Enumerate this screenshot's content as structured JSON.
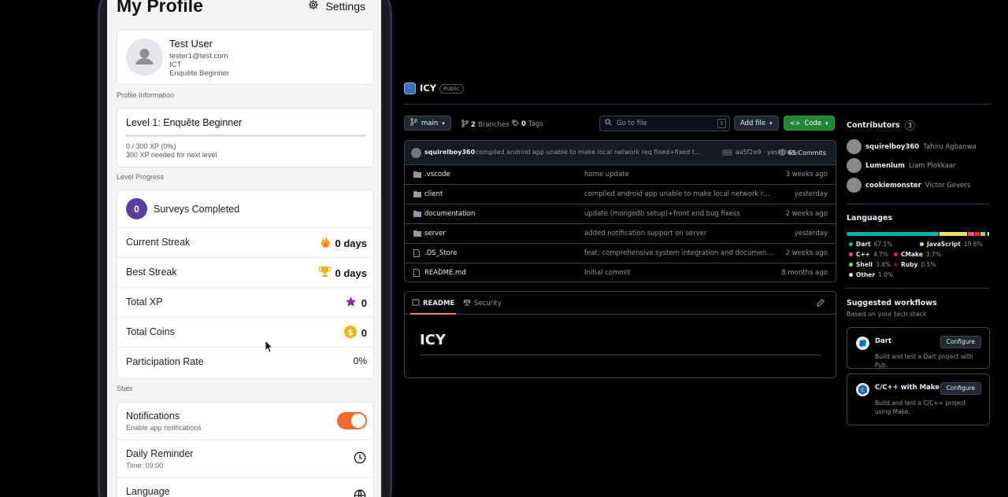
{
  "profile": {
    "title": "My Profile",
    "settings_label": "Settings",
    "user": {
      "name": "Test User",
      "email": "tester1@test.com",
      "org": "ICT",
      "rank": "Enquête Beginner"
    },
    "section_profile_info": "Profile Information",
    "level": {
      "title": "Level 1: Enquête Beginner",
      "xp_text": "0 / 300 XP (0%)",
      "next_text": "300 XP needed for next level",
      "progress_fraction": 0
    },
    "section_level_progress": "Level Progress",
    "stats": {
      "surveys_count": "0",
      "surveys_label": "Surveys Completed",
      "current_streak_label": "Current Streak",
      "current_streak_value": "0 days",
      "best_streak_label": "Best Streak",
      "best_streak_value": "0 days",
      "total_xp_label": "Total XP",
      "total_xp_value": "0",
      "total_coins_label": "Total Coins",
      "total_coins_value": "0",
      "participation_label": "Participation Rate",
      "participation_value": "0%"
    },
    "section_stats": "Stats",
    "prefs": {
      "notifications_label": "Notifications",
      "notifications_sub": "Enable app notifications",
      "notifications_on": true,
      "reminder_label": "Daily Reminder",
      "reminder_sub": "Time: 09:00",
      "language_label": "Language"
    },
    "colors": {
      "accent": "#5b3f9c",
      "toggle": "#f26a2e"
    }
  },
  "github": {
    "repo_name": "ICY",
    "visibility": "Public",
    "branch": "main",
    "branches_count": "2",
    "branches_label": "Branches",
    "tags_count": "0",
    "tags_label": "Tags",
    "search_placeholder": "Go to file",
    "search_kbd": "t",
    "add_file_label": "Add file",
    "code_label": "Code",
    "latest_commit": {
      "author": "squirelboy360",
      "message": "compiled android app unable to make local network req fixed+fixed t...",
      "hash_time": "aa5f2e9 · yesterday",
      "commits": "65 Commits"
    },
    "files": [
      {
        "name": ".vscode",
        "type": "folder",
        "commit": "home update",
        "time": "3 weeks ago"
      },
      {
        "name": "client",
        "type": "folder",
        "commit": "compiled android app unable to make local network req ...",
        "time": "yesterday"
      },
      {
        "name": "documentation",
        "type": "folder",
        "commit": "update (mongodb setup)+front end bug fixess",
        "time": "2 weeks ago"
      },
      {
        "name": "server",
        "type": "folder",
        "commit": "added notification support on server",
        "time": "yesterday"
      },
      {
        "name": ".DS_Store",
        "type": "file",
        "commit": "feat: comprehensive system integration and documentat...",
        "time": "2 weeks ago"
      },
      {
        "name": "README.md",
        "type": "file",
        "commit": "Initial commit",
        "time": "8 months ago"
      }
    ],
    "readme": {
      "tab_readme": "README",
      "tab_security": "Security",
      "heading": "ICY"
    },
    "contributors": {
      "title": "Contributors",
      "count": "3",
      "list": [
        {
          "handle": "squirelboy360",
          "name": "Tahiru Agbanwa"
        },
        {
          "handle": "Lumenlum",
          "name": "Liam Plokkaar"
        },
        {
          "handle": "cookiemonster",
          "name": "Victor Gevers"
        }
      ]
    },
    "languages": {
      "title": "Languages",
      "list": [
        {
          "name": "Dart",
          "pct": "67.1%",
          "value": 67.1,
          "color": "#00b4ab"
        },
        {
          "name": "JavaScript",
          "pct": "19.6%",
          "value": 19.6,
          "color": "#f1e05a"
        },
        {
          "name": "C++",
          "pct": "4.7%",
          "value": 4.7,
          "color": "#f34b7d"
        },
        {
          "name": "CMake",
          "pct": "3.7%",
          "value": 3.7,
          "color": "#da3434"
        },
        {
          "name": "Shell",
          "pct": "3.4%",
          "value": 3.4,
          "color": "#89e051"
        },
        {
          "name": "Ruby",
          "pct": "0.5%",
          "value": 0.5,
          "color": "#701516"
        },
        {
          "name": "Other",
          "pct": "1.0%",
          "value": 1.0,
          "color": "#ededed"
        }
      ]
    },
    "workflows": {
      "title": "Suggested workflows",
      "subtitle": "Based on your tech stack",
      "list": [
        {
          "title": "Dart",
          "desc": "Build and test a Dart project with Pub.",
          "button": "Configure"
        },
        {
          "title": "C/C++ with Make",
          "desc": "Build and test a C/C++ project using Make.",
          "button": "Configure"
        }
      ]
    }
  }
}
